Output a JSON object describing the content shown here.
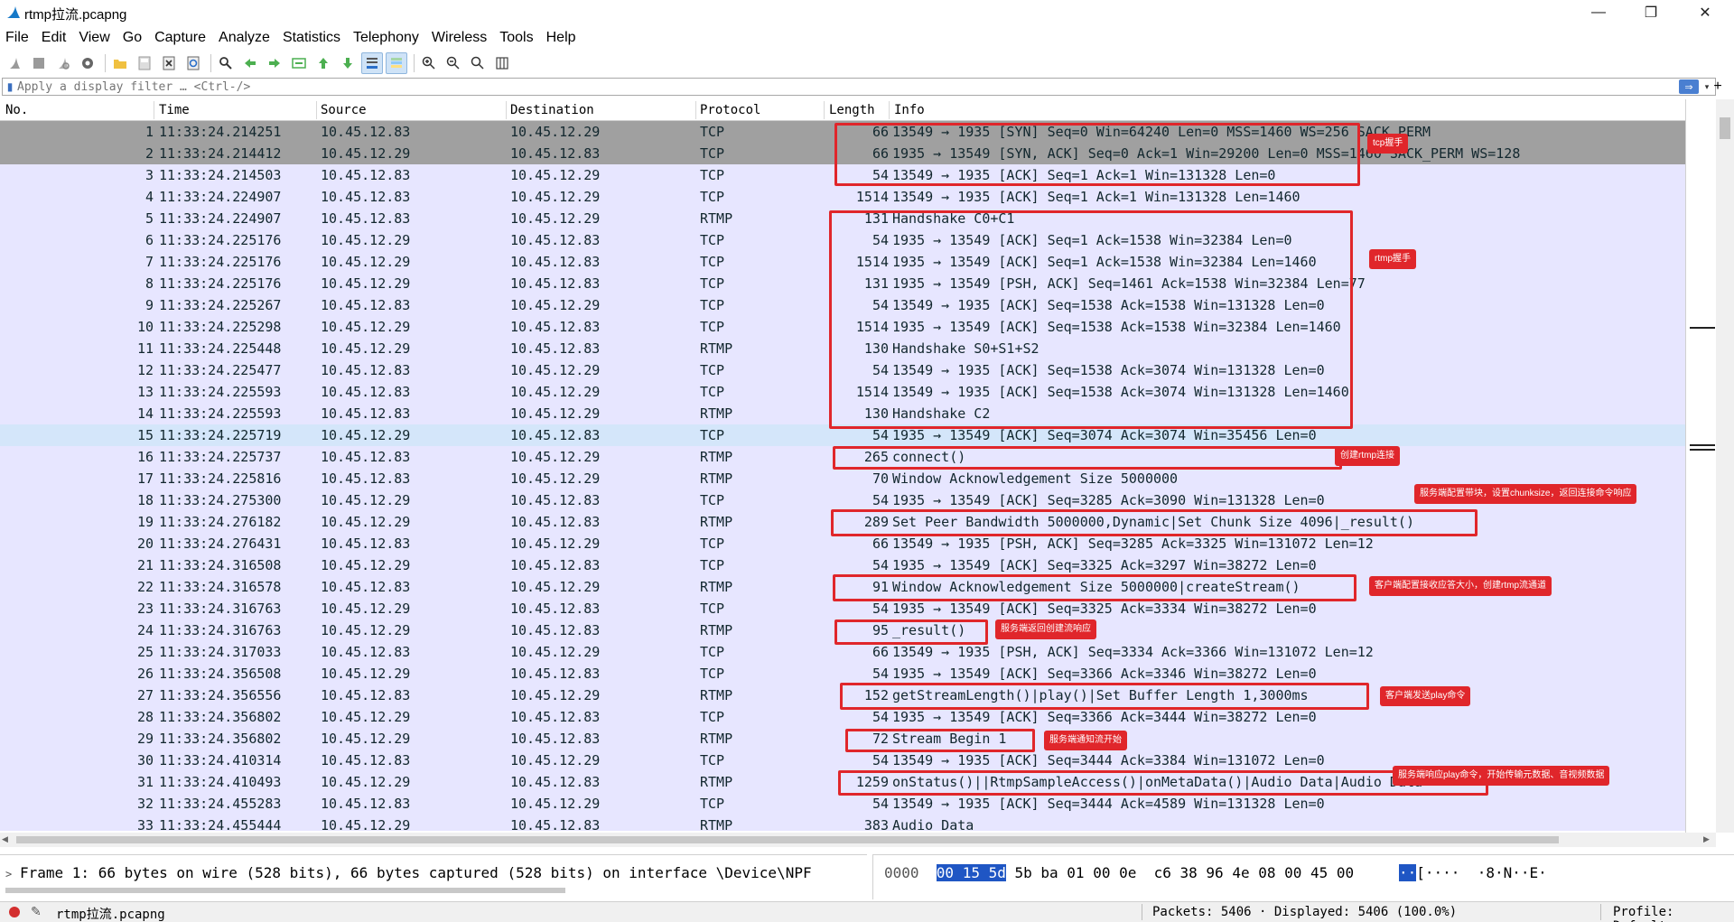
{
  "window": {
    "title": "rtmp拉流.pcapng",
    "minimize": "—",
    "maximize": "❐",
    "close": "✕"
  },
  "menu": [
    {
      "label": "File",
      "name": "menu-file"
    },
    {
      "label": "Edit",
      "name": "menu-edit"
    },
    {
      "label": "View",
      "name": "menu-view"
    },
    {
      "label": "Go",
      "name": "menu-go"
    },
    {
      "label": "Capture",
      "name": "menu-capture"
    },
    {
      "label": "Analyze",
      "name": "menu-analyze"
    },
    {
      "label": "Statistics",
      "name": "menu-statistics"
    },
    {
      "label": "Telephony",
      "name": "menu-telephony"
    },
    {
      "label": "Wireless",
      "name": "menu-wireless"
    },
    {
      "label": "Tools",
      "name": "menu-tools"
    },
    {
      "label": "Help",
      "name": "menu-help"
    }
  ],
  "toolbar_icons": [
    "start-capture-icon",
    "stop-capture-icon",
    "restart-capture-icon",
    "capture-options-icon",
    "open-file-icon",
    "save-file-icon",
    "close-file-icon",
    "reload-file-icon",
    "find-packet-icon",
    "go-back-icon",
    "go-forward-icon",
    "go-to-packet-icon",
    "first-packet-icon",
    "last-packet-icon",
    "autoscroll-icon",
    "colorize-icon",
    "zoom-in-icon",
    "zoom-out-icon",
    "normal-size-icon",
    "resize-columns-icon"
  ],
  "filter": {
    "placeholder": "Apply a display filter … <Ctrl-/>",
    "value": "",
    "apply": "⇒",
    "dropdown": "▾",
    "add": "+"
  },
  "columns": {
    "no": "No.",
    "time": "Time",
    "source": "Source",
    "destination": "Destination",
    "protocol": "Protocol",
    "length": "Length",
    "info": "Info"
  },
  "packets": [
    {
      "no": "1",
      "time": "11:33:24.214251",
      "src": "10.45.12.83",
      "dst": "10.45.12.29",
      "proto": "TCP",
      "len": "66",
      "info": "13549 → 1935 [SYN] Seq=0 Win=64240 Len=0 MSS=1460 WS=256 SACK_PERM",
      "style": "hl-dark"
    },
    {
      "no": "2",
      "time": "11:33:24.214412",
      "src": "10.45.12.29",
      "dst": "10.45.12.83",
      "proto": "TCP",
      "len": "66",
      "info": "1935 → 13549 [SYN, ACK] Seq=0 Ack=1 Win=29200 Len=0 MSS=1460 SACK_PERM WS=128",
      "style": "hl-dark"
    },
    {
      "no": "3",
      "time": "11:33:24.214503",
      "src": "10.45.12.83",
      "dst": "10.45.12.29",
      "proto": "TCP",
      "len": "54",
      "info": "13549 → 1935 [ACK] Seq=1 Ack=1 Win=131328 Len=0",
      "style": "tcp"
    },
    {
      "no": "4",
      "time": "11:33:24.224907",
      "src": "10.45.12.83",
      "dst": "10.45.12.29",
      "proto": "TCP",
      "len": "1514",
      "info": "13549 → 1935 [ACK] Seq=1 Ack=1 Win=131328 Len=1460",
      "style": "tcp"
    },
    {
      "no": "5",
      "time": "11:33:24.224907",
      "src": "10.45.12.83",
      "dst": "10.45.12.29",
      "proto": "RTMP",
      "len": "131",
      "info": "Handshake C0+C1",
      "style": "rtmp"
    },
    {
      "no": "6",
      "time": "11:33:24.225176",
      "src": "10.45.12.29",
      "dst": "10.45.12.83",
      "proto": "TCP",
      "len": "54",
      "info": "1935 → 13549 [ACK] Seq=1 Ack=1538 Win=32384 Len=0",
      "style": "tcp"
    },
    {
      "no": "7",
      "time": "11:33:24.225176",
      "src": "10.45.12.29",
      "dst": "10.45.12.83",
      "proto": "TCP",
      "len": "1514",
      "info": "1935 → 13549 [ACK] Seq=1 Ack=1538 Win=32384 Len=1460",
      "style": "tcp"
    },
    {
      "no": "8",
      "time": "11:33:24.225176",
      "src": "10.45.12.29",
      "dst": "10.45.12.83",
      "proto": "TCP",
      "len": "131",
      "info": "1935 → 13549 [PSH, ACK] Seq=1461 Ack=1538 Win=32384 Len=77",
      "style": "tcp"
    },
    {
      "no": "9",
      "time": "11:33:24.225267",
      "src": "10.45.12.83",
      "dst": "10.45.12.29",
      "proto": "TCP",
      "len": "54",
      "info": "13549 → 1935 [ACK] Seq=1538 Ack=1538 Win=131328 Len=0",
      "style": "tcp"
    },
    {
      "no": "10",
      "time": "11:33:24.225298",
      "src": "10.45.12.29",
      "dst": "10.45.12.83",
      "proto": "TCP",
      "len": "1514",
      "info": "1935 → 13549 [ACK] Seq=1538 Ack=1538 Win=32384 Len=1460",
      "style": "tcp"
    },
    {
      "no": "11",
      "time": "11:33:24.225448",
      "src": "10.45.12.29",
      "dst": "10.45.12.83",
      "proto": "RTMP",
      "len": "130",
      "info": "Handshake S0+S1+S2",
      "style": "rtmp"
    },
    {
      "no": "12",
      "time": "11:33:24.225477",
      "src": "10.45.12.83",
      "dst": "10.45.12.29",
      "proto": "TCP",
      "len": "54",
      "info": "13549 → 1935 [ACK] Seq=1538 Ack=3074 Win=131328 Len=0",
      "style": "tcp"
    },
    {
      "no": "13",
      "time": "11:33:24.225593",
      "src": "10.45.12.83",
      "dst": "10.45.12.29",
      "proto": "TCP",
      "len": "1514",
      "info": "13549 → 1935 [ACK] Seq=1538 Ack=3074 Win=131328 Len=1460",
      "style": "tcp"
    },
    {
      "no": "14",
      "time": "11:33:24.225593",
      "src": "10.45.12.83",
      "dst": "10.45.12.29",
      "proto": "RTMP",
      "len": "130",
      "info": "Handshake C2",
      "style": "rtmp"
    },
    {
      "no": "15",
      "time": "11:33:24.225719",
      "src": "10.45.12.29",
      "dst": "10.45.12.83",
      "proto": "TCP",
      "len": "54",
      "info": "1935 → 13549 [ACK] Seq=3074 Ack=3074 Win=35456 Len=0",
      "style": "hl-light"
    },
    {
      "no": "16",
      "time": "11:33:24.225737",
      "src": "10.45.12.83",
      "dst": "10.45.12.29",
      "proto": "RTMP",
      "len": "265",
      "info": "connect()",
      "style": "rtmp"
    },
    {
      "no": "17",
      "time": "11:33:24.225816",
      "src": "10.45.12.83",
      "dst": "10.45.12.29",
      "proto": "RTMP",
      "len": "70",
      "info": "Window Acknowledgement Size 5000000",
      "style": "rtmp"
    },
    {
      "no": "18",
      "time": "11:33:24.275300",
      "src": "10.45.12.29",
      "dst": "10.45.12.83",
      "proto": "TCP",
      "len": "54",
      "info": "1935 → 13549 [ACK] Seq=3285 Ack=3090 Win=131328 Len=0",
      "style": "tcp"
    },
    {
      "no": "19",
      "time": "11:33:24.276182",
      "src": "10.45.12.29",
      "dst": "10.45.12.83",
      "proto": "RTMP",
      "len": "289",
      "info": "Set Peer Bandwidth 5000000,Dynamic|Set Chunk Size 4096|_result()",
      "style": "rtmp"
    },
    {
      "no": "20",
      "time": "11:33:24.276431",
      "src": "10.45.12.83",
      "dst": "10.45.12.29",
      "proto": "TCP",
      "len": "66",
      "info": "13549 → 1935 [PSH, ACK] Seq=3285 Ack=3325 Win=131072 Len=12",
      "style": "tcp"
    },
    {
      "no": "21",
      "time": "11:33:24.316508",
      "src": "10.45.12.29",
      "dst": "10.45.12.83",
      "proto": "TCP",
      "len": "54",
      "info": "1935 → 13549 [ACK] Seq=3325 Ack=3297 Win=38272 Len=0",
      "style": "tcp"
    },
    {
      "no": "22",
      "time": "11:33:24.316578",
      "src": "10.45.12.83",
      "dst": "10.45.12.29",
      "proto": "RTMP",
      "len": "91",
      "info": "Window Acknowledgement Size 5000000|createStream()",
      "style": "rtmp"
    },
    {
      "no": "23",
      "time": "11:33:24.316763",
      "src": "10.45.12.29",
      "dst": "10.45.12.83",
      "proto": "TCP",
      "len": "54",
      "info": "1935 → 13549 [ACK] Seq=3325 Ack=3334 Win=38272 Len=0",
      "style": "tcp"
    },
    {
      "no": "24",
      "time": "11:33:24.316763",
      "src": "10.45.12.29",
      "dst": "10.45.12.83",
      "proto": "RTMP",
      "len": "95",
      "info": "_result()",
      "style": "rtmp"
    },
    {
      "no": "25",
      "time": "11:33:24.317033",
      "src": "10.45.12.83",
      "dst": "10.45.12.29",
      "proto": "TCP",
      "len": "66",
      "info": "13549 → 1935 [PSH, ACK] Seq=3334 Ack=3366 Win=131072 Len=12",
      "style": "tcp"
    },
    {
      "no": "26",
      "time": "11:33:24.356508",
      "src": "10.45.12.29",
      "dst": "10.45.12.83",
      "proto": "TCP",
      "len": "54",
      "info": "1935 → 13549 [ACK] Seq=3366 Ack=3346 Win=38272 Len=0",
      "style": "tcp"
    },
    {
      "no": "27",
      "time": "11:33:24.356556",
      "src": "10.45.12.83",
      "dst": "10.45.12.29",
      "proto": "RTMP",
      "len": "152",
      "info": "getStreamLength()|play()|Set Buffer Length 1,3000ms",
      "style": "rtmp"
    },
    {
      "no": "28",
      "time": "11:33:24.356802",
      "src": "10.45.12.29",
      "dst": "10.45.12.83",
      "proto": "TCP",
      "len": "54",
      "info": "1935 → 13549 [ACK] Seq=3366 Ack=3444 Win=38272 Len=0",
      "style": "tcp"
    },
    {
      "no": "29",
      "time": "11:33:24.356802",
      "src": "10.45.12.29",
      "dst": "10.45.12.83",
      "proto": "RTMP",
      "len": "72",
      "info": "Stream Begin 1",
      "style": "rtmp"
    },
    {
      "no": "30",
      "time": "11:33:24.410314",
      "src": "10.45.12.83",
      "dst": "10.45.12.29",
      "proto": "TCP",
      "len": "54",
      "info": "13549 → 1935 [ACK] Seq=3444 Ack=3384 Win=131072 Len=0",
      "style": "tcp"
    },
    {
      "no": "31",
      "time": "11:33:24.410493",
      "src": "10.45.12.29",
      "dst": "10.45.12.83",
      "proto": "RTMP",
      "len": "1259",
      "info": "onStatus()||RtmpSampleAccess()|onMetaData()|Audio Data|Audio Data",
      "style": "rtmp"
    },
    {
      "no": "32",
      "time": "11:33:24.455283",
      "src": "10.45.12.83",
      "dst": "10.45.12.29",
      "proto": "TCP",
      "len": "54",
      "info": "13549 → 1935 [ACK] Seq=3444 Ack=4589 Win=131328 Len=0",
      "style": "tcp"
    },
    {
      "no": "33",
      "time": "11:33:24.455444",
      "src": "10.45.12.29",
      "dst": "10.45.12.83",
      "proto": "RTMP",
      "len": "383",
      "info": "Audio Data",
      "style": "rtmp"
    }
  ],
  "annotations": [
    {
      "name": "tcp-handshake-annotation",
      "label": "tcp握手"
    },
    {
      "name": "rtmp-handshake-annotation",
      "label": "rtmp握手"
    },
    {
      "name": "connect-annotation",
      "label": "创建rtmp连接"
    },
    {
      "name": "bandwidth-annotation",
      "label": "服务端配置带块，设置chunksize，返回连接命令响应"
    },
    {
      "name": "createstream-annotation",
      "label": "客户端配置接收应答大小，创建rtmp流通道"
    },
    {
      "name": "result-annotation",
      "label": "服务端返回创建流响应"
    },
    {
      "name": "play-annotation",
      "label": "客户端发送play命令"
    },
    {
      "name": "stream-begin-annotation",
      "label": "服务端通知流开始"
    },
    {
      "name": "onstatus-annotation",
      "label": "服务端响应play命令，开始传输元数据、音视频数据"
    }
  ],
  "detail": {
    "arrow": ">",
    "text": "Frame 1: 66 bytes on wire (528 bits), 66 bytes captured (528 bits) on interface \\Device\\NPF"
  },
  "bytes": {
    "offset": "0000",
    "selected": "00 15 5d",
    "rest": " 5b ba 01 00 0e  c6 38 96 4e 08 00 45 00",
    "ascii_selected": "··",
    "ascii_rest": "[····  ·8·N··E·"
  },
  "status": {
    "file": "rtmp拉流.pcapng",
    "packets": "Packets: 5406 · Displayed: 5406 (100.0%)",
    "profile": "Profile: Default"
  },
  "colors": {
    "row_default": "#e7e6ff",
    "row_selected": "#a0a0a0",
    "row_hover": "#d4e6fa",
    "annotation": "#e0262b"
  }
}
